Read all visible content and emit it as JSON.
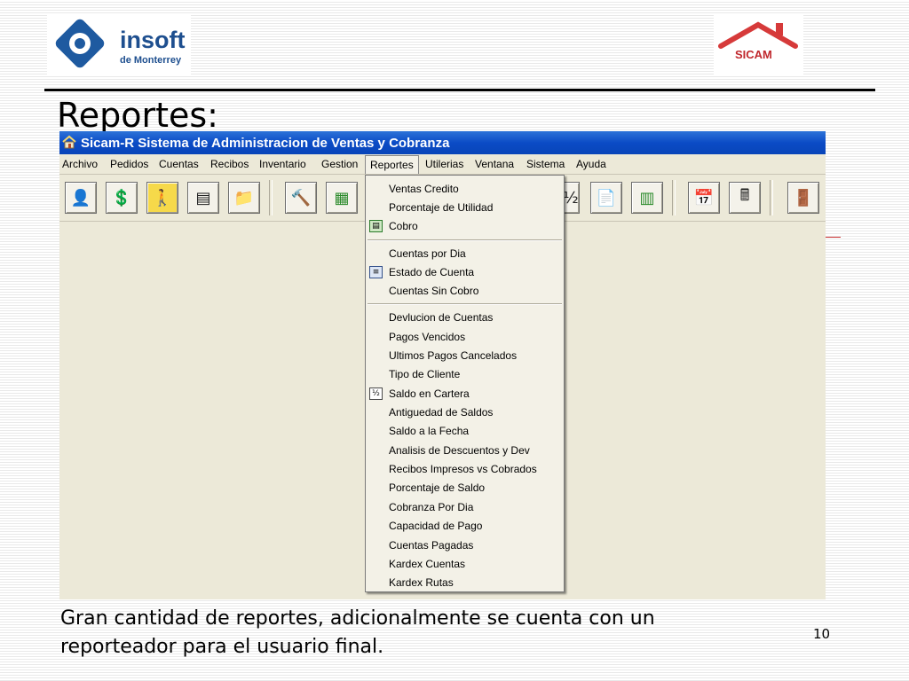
{
  "logos": {
    "left": {
      "name": "insoft",
      "sub": "de Monterrey"
    },
    "right": {
      "name": "SICAM"
    }
  },
  "slide": {
    "title": "Reportes:",
    "caption": "Gran cantidad de reportes, adicionalmente se cuenta con un reporteador para el usuario final.",
    "page_number": "10"
  },
  "app": {
    "title": "Sicam-R  Sistema de Administracion de Ventas y Cobranza",
    "menus": [
      {
        "label": "Archivo"
      },
      {
        "label": "Pedidos"
      },
      {
        "label": "Cuentas"
      },
      {
        "label": "Recibos"
      },
      {
        "label": "Inventario"
      },
      {
        "label": "Gestion"
      },
      {
        "label": "Reportes"
      },
      {
        "label": "Utilerias"
      },
      {
        "label": "Ventana"
      },
      {
        "label": "Sistema"
      },
      {
        "label": "Ayuda"
      }
    ],
    "toolbar_icons": [
      "customer-icon",
      "payments-icon",
      "collector-icon",
      "receipt-icon",
      "folder-icon",
      "hammer-icon",
      "ledger-icon",
      "schedule-icon",
      "document-icon",
      "sheet-icon",
      "calendar-icon",
      "calculator-icon",
      "exit-door-icon"
    ],
    "reportes_menu": [
      {
        "label": "Ventas Credito"
      },
      {
        "label": "Porcentaje de Utilidad"
      },
      {
        "label": "Cobro",
        "icon": "green-sheet-icon"
      },
      {
        "label": "Cuentas por Dia"
      },
      {
        "label": "Estado de Cuenta",
        "icon": "statement-icon"
      },
      {
        "label": "Cuentas Sin Cobro"
      },
      {
        "label": "Devlucion de Cuentas"
      },
      {
        "label": "Pagos Vencidos"
      },
      {
        "label": "Ultimos Pagos Cancelados"
      },
      {
        "label": "Tipo de Cliente"
      },
      {
        "label": "Saldo en Cartera",
        "icon": "balance-icon"
      },
      {
        "label": "Antiguedad de Saldos"
      },
      {
        "label": "Saldo a la Fecha"
      },
      {
        "label": "Analisis de Descuentos y Dev"
      },
      {
        "label": "Recibos Impresos vs Cobrados"
      },
      {
        "label": "Porcentaje de Saldo"
      },
      {
        "label": "Cobranza Por Dia"
      },
      {
        "label": "Capacidad de Pago"
      },
      {
        "label": "Cuentas Pagadas"
      },
      {
        "label": "Kardex Cuentas"
      },
      {
        "label": "Kardex Rutas"
      }
    ]
  }
}
